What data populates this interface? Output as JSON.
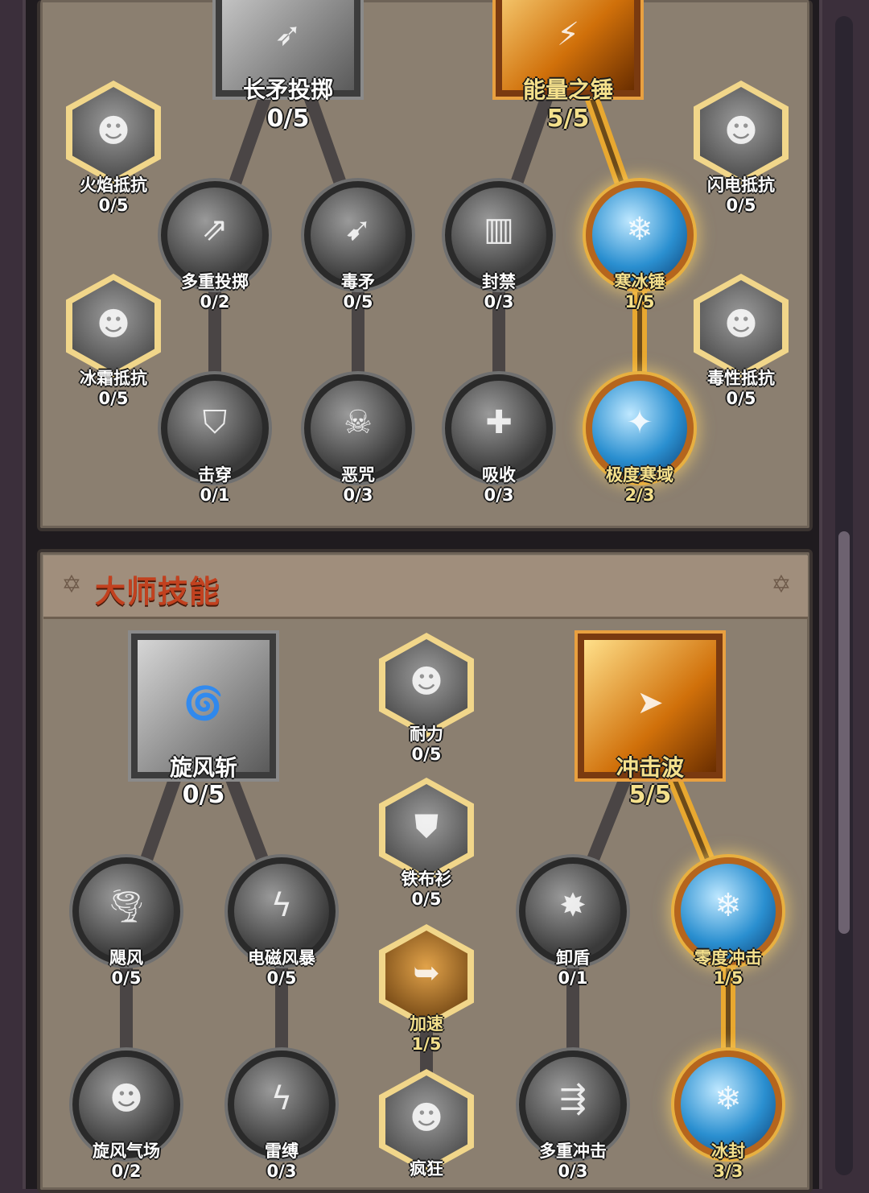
{
  "colors": {
    "active_line": "#e8a830",
    "inactive_line": "#4a4545",
    "title": "#c2411f",
    "gold_text": "#f4e08c"
  },
  "section_master": {
    "title": "大师技能"
  },
  "tree1": {
    "spear": {
      "name": "长矛投掷",
      "count": "0/5"
    },
    "hammer": {
      "name": "能量之锤",
      "count": "5/5"
    },
    "fire_res": {
      "name": "火焰抵抗",
      "count": "0/5"
    },
    "lightning_res": {
      "name": "闪电抵抗",
      "count": "0/5"
    },
    "frost_res": {
      "name": "冰霜抵抗",
      "count": "0/5"
    },
    "poison_res": {
      "name": "毒性抵抗",
      "count": "0/5"
    },
    "multi_throw": {
      "name": "多重投掷",
      "count": "0/2"
    },
    "poison_spear": {
      "name": "毒矛",
      "count": "0/5"
    },
    "seal": {
      "name": "封禁",
      "count": "0/3"
    },
    "ice_hammer": {
      "name": "寒冰锤",
      "count": "1/5"
    },
    "pierce": {
      "name": "击穿",
      "count": "0/1"
    },
    "curse": {
      "name": "恶咒",
      "count": "0/3"
    },
    "absorb": {
      "name": "吸收",
      "count": "0/3"
    },
    "frost_domain": {
      "name": "极度寒域",
      "count": "2/3"
    }
  },
  "tree2": {
    "whirlwind": {
      "name": "旋风斩",
      "count": "0/5"
    },
    "shockwave": {
      "name": "冲击波",
      "count": "5/5"
    },
    "endurance": {
      "name": "耐力",
      "count": "0/5"
    },
    "iron_shirt": {
      "name": "铁布衫",
      "count": "0/5"
    },
    "haste": {
      "name": "加速",
      "count": "1/5"
    },
    "frenzy": {
      "name": "疯狂"
    },
    "gale": {
      "name": "飓风",
      "count": "0/5"
    },
    "em_storm": {
      "name": "电磁风暴",
      "count": "0/5"
    },
    "unshield": {
      "name": "卸盾",
      "count": "0/1"
    },
    "zero_impact": {
      "name": "零度冲击",
      "count": "1/5"
    },
    "whirl_field": {
      "name": "旋风气场",
      "count": "0/2"
    },
    "thunder_bind": {
      "name": "雷缚",
      "count": "0/3"
    },
    "multi_impact": {
      "name": "多重冲击",
      "count": "0/3"
    },
    "freeze": {
      "name": "冰封",
      "count": "3/3"
    }
  }
}
